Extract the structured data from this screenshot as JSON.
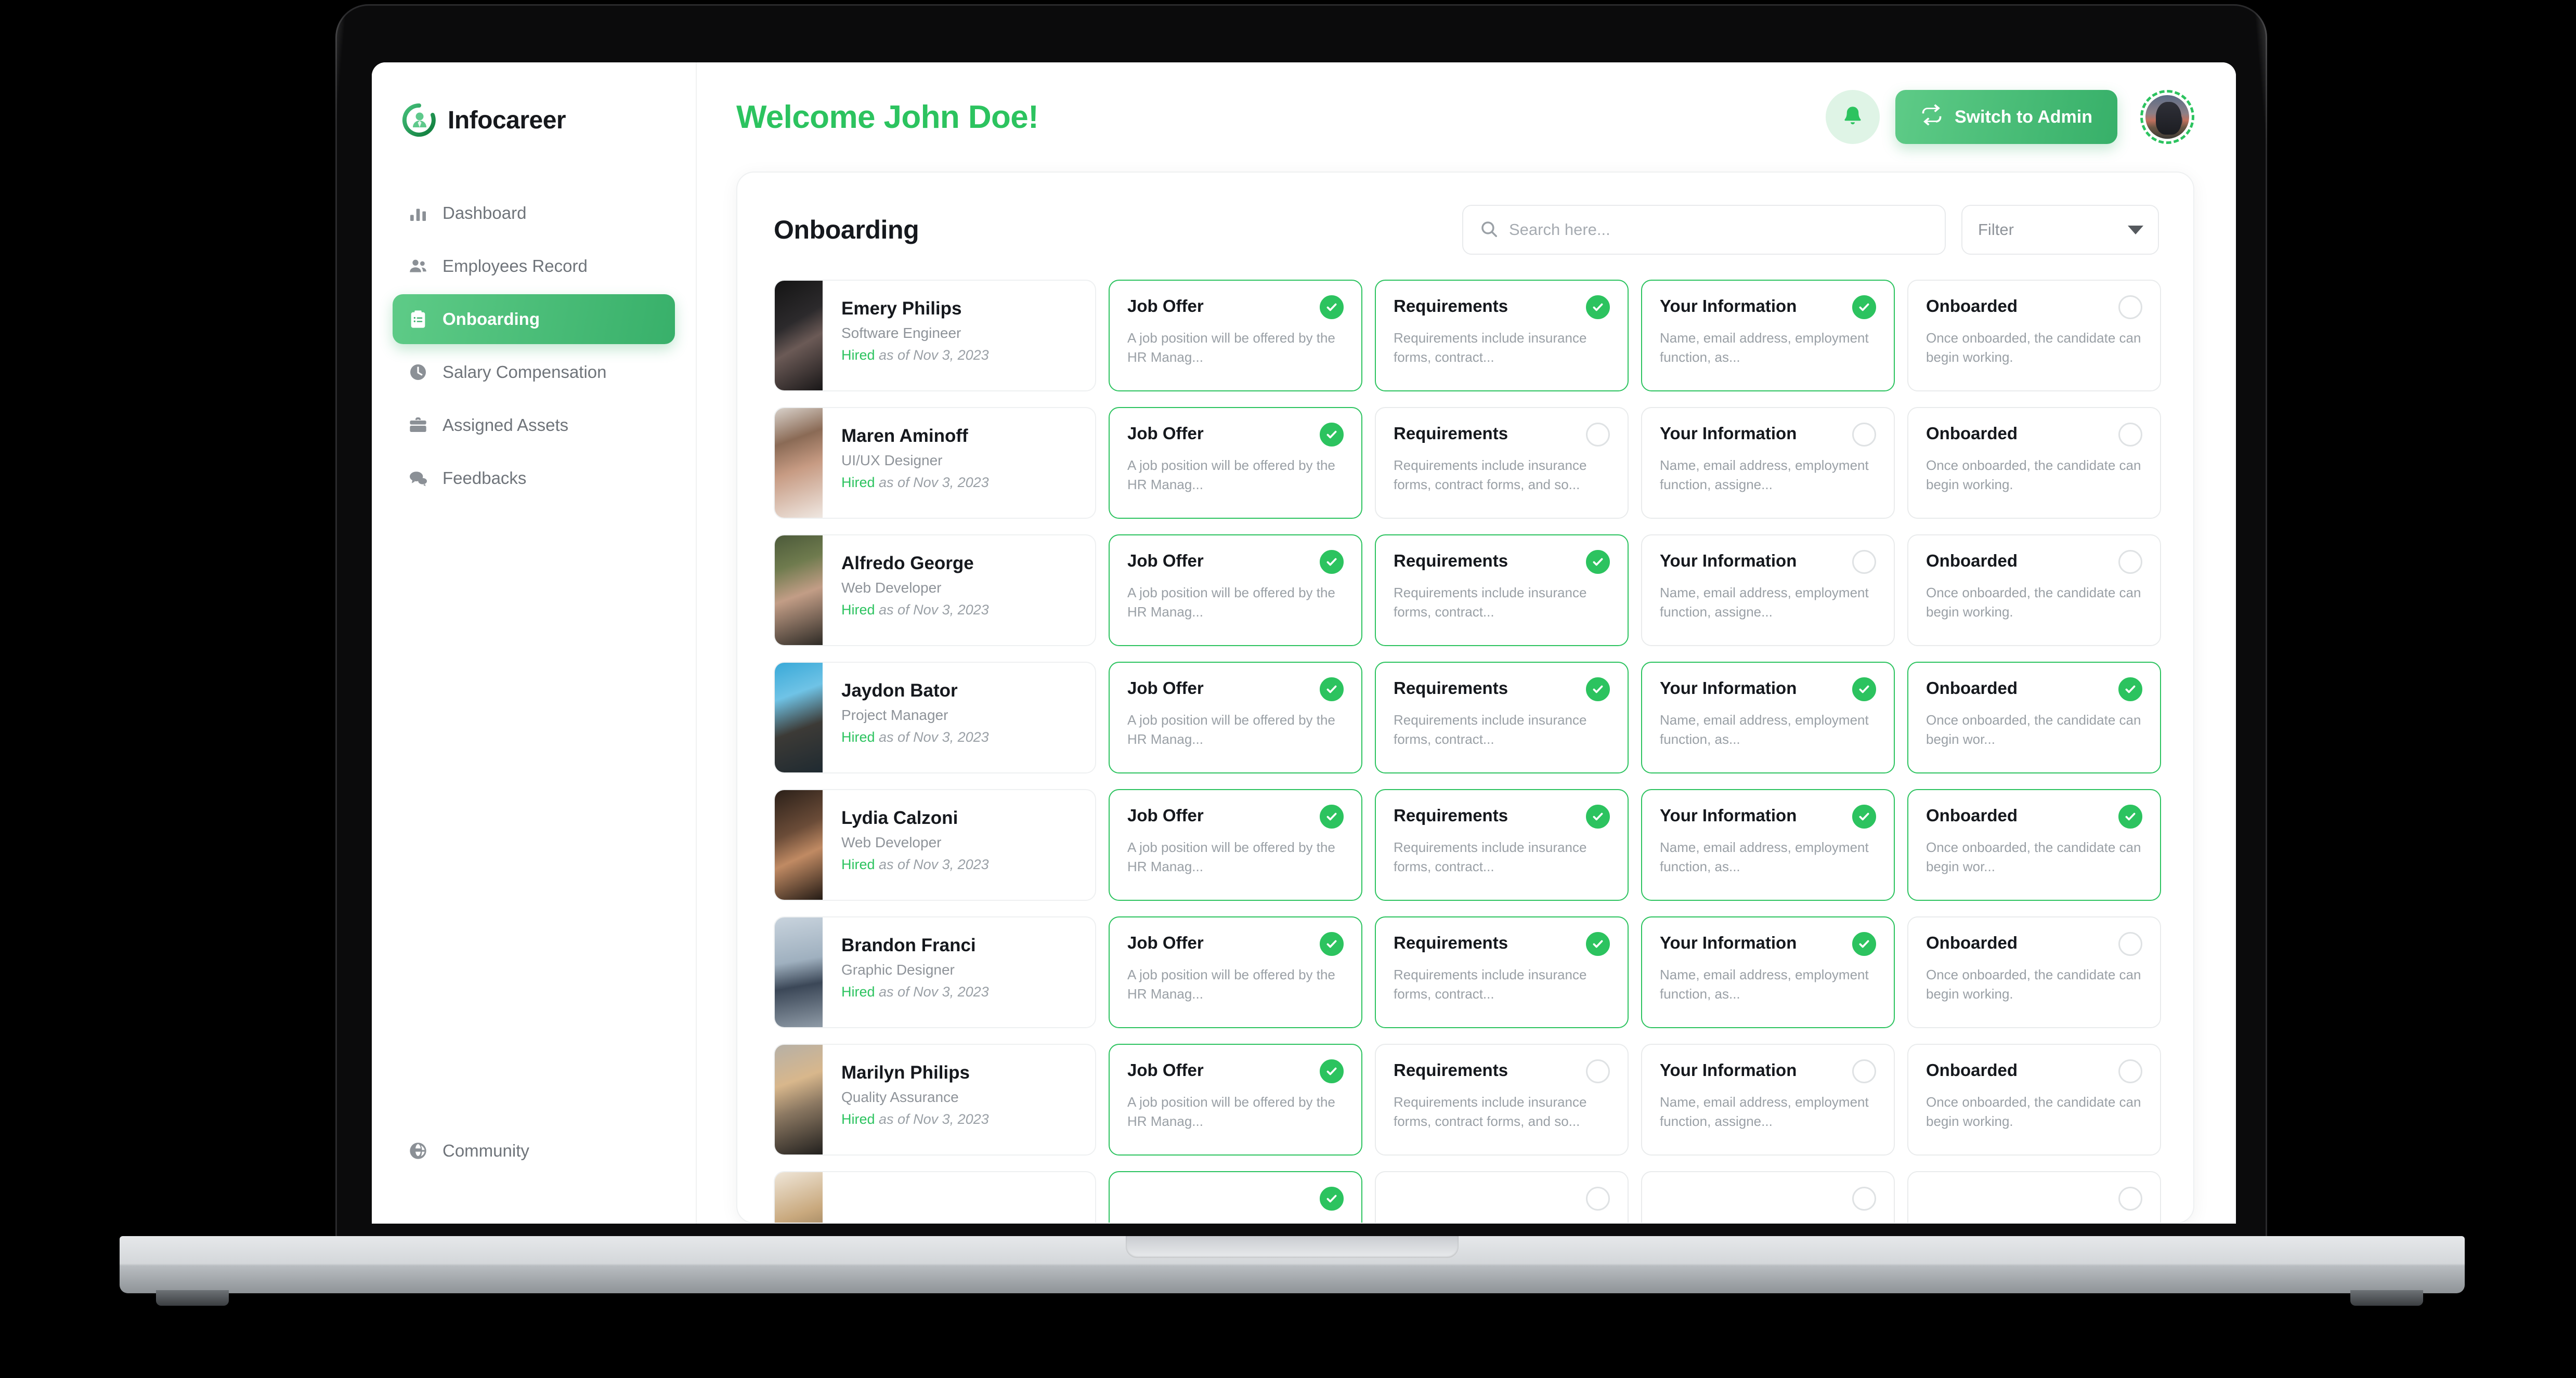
{
  "brand": {
    "name": "Infocareer",
    "logo_icon": "infocareer-person-circle-logo",
    "accent": "#2cc35f"
  },
  "sidebar": {
    "items": [
      {
        "label": "Dashboard",
        "icon": "bar-chart-icon",
        "active": false
      },
      {
        "label": "Employees Record",
        "icon": "people-icon",
        "active": false
      },
      {
        "label": "Onboarding",
        "icon": "clipboard-list-icon",
        "active": true
      },
      {
        "label": "Salary Compensation",
        "icon": "clock-icon",
        "active": false
      },
      {
        "label": "Assigned Assets",
        "icon": "briefcase-icon",
        "active": false
      },
      {
        "label": "Feedbacks",
        "icon": "chat-bubbles-icon",
        "active": false
      }
    ],
    "bottom": {
      "label": "Community",
      "icon": "globe-icon"
    }
  },
  "topbar": {
    "welcome": "Welcome John Doe!",
    "notifications_icon": "bell-icon",
    "switch_label": "Switch to Admin",
    "switch_icon": "swap-arrows-icon",
    "avatar_name": "user-avatar"
  },
  "panel": {
    "title": "Onboarding",
    "search": {
      "placeholder": "Search here...",
      "value": "",
      "icon": "search-icon"
    },
    "filter": {
      "label": "Filter",
      "icon": "chevron-down-icon"
    }
  },
  "stage_text": {
    "job_offer_title": "Job Offer",
    "job_offer_desc": "A job position will be offered by the HR Manag...",
    "requirements_title": "Requirements",
    "requirements_desc_short": "Requirements include insurance forms, contract...",
    "requirements_desc_long": "Requirements include insurance forms, contract forms, and so...",
    "your_info_title": "Your Information",
    "your_info_desc_short": "Name, email address, employment function, as...",
    "your_info_desc_long": "Name, email address, employment function, assigne...",
    "onboarded_title": "Onboarded",
    "onboarded_desc_pending": "Once onboarded, the candidate can begin working.",
    "onboarded_desc_done": "Once onboarded, the candidate can begin wor..."
  },
  "employees": [
    {
      "name": "Emery Philips",
      "role": "Software Engineer",
      "status_label": "Hired",
      "status_date": "as of Nov 3, 2023",
      "photo": "linear-gradient(150deg,#141414 0%,#2c2a2c 38%,#6b5a56 58%,#191718 100%)",
      "stages": [
        {
          "title": "Job Offer",
          "desc": "A job position will be offered by the HR Manag...",
          "done": true
        },
        {
          "title": "Requirements",
          "desc": "Requirements include insurance forms, contract...",
          "done": true
        },
        {
          "title": "Your Information",
          "desc": "Name, email address, employment function, as...",
          "done": true
        },
        {
          "title": "Onboarded",
          "desc": "Once onboarded, the candidate can begin working.",
          "done": false
        }
      ]
    },
    {
      "name": "Maren Aminoff",
      "role": "UI/UX Designer",
      "status_label": "Hired",
      "status_date": "as of Nov 3, 2023",
      "photo": "linear-gradient(160deg,#d9d2cb 0%,#8a6a55 30%,#c79b83 55%,#efe7e1 100%)",
      "stages": [
        {
          "title": "Job Offer",
          "desc": "A job position will be offered by the HR Manag...",
          "done": true
        },
        {
          "title": "Requirements",
          "desc": "Requirements include insurance forms, contract forms, and so...",
          "done": false
        },
        {
          "title": "Your Information",
          "desc": "Name, email address, employment function, assigne...",
          "done": false
        },
        {
          "title": "Onboarded",
          "desc": "Once onboarded, the candidate can begin working.",
          "done": false
        }
      ]
    },
    {
      "name": "Alfredo George",
      "role": "Web Developer",
      "status_label": "Hired",
      "status_date": "as of Nov 3, 2023",
      "photo": "linear-gradient(160deg,#4c5a3a 0%,#6f7b4e 28%,#c29d86 54%,#2e2b26 100%)",
      "stages": [
        {
          "title": "Job Offer",
          "desc": "A job position will be offered by the HR Manag...",
          "done": true
        },
        {
          "title": "Requirements",
          "desc": "Requirements include insurance forms, contract...",
          "done": true
        },
        {
          "title": "Your Information",
          "desc": "Name, email address, employment function, assigne...",
          "done": false
        },
        {
          "title": "Onboarded",
          "desc": "Once onboarded, the candidate can begin working.",
          "done": false
        }
      ]
    },
    {
      "name": "Jaydon Bator",
      "role": "Project Manager",
      "status_label": "Hired",
      "status_date": "as of Nov 3, 2023",
      "photo": "linear-gradient(160deg,#39a9d8 0%,#6fc3e6 30%,#3c3a36 60%,#1f2a31 100%)",
      "stages": [
        {
          "title": "Job Offer",
          "desc": "A job position will be offered by the HR Manag...",
          "done": true
        },
        {
          "title": "Requirements",
          "desc": "Requirements include insurance forms, contract...",
          "done": true
        },
        {
          "title": "Your Information",
          "desc": "Name, email address, employment function, as...",
          "done": true
        },
        {
          "title": "Onboarded",
          "desc": "Once onboarded, the candidate can begin wor...",
          "done": true
        }
      ]
    },
    {
      "name": "Lydia Calzoni",
      "role": "Web Developer",
      "status_label": "Hired",
      "status_date": "as of Nov 3, 2023",
      "photo": "linear-gradient(155deg,#2b2019 0%,#6b4c38 38%,#c08a63 60%,#241b15 100%)",
      "stages": [
        {
          "title": "Job Offer",
          "desc": "A job position will be offered by the HR Manag...",
          "done": true
        },
        {
          "title": "Requirements",
          "desc": "Requirements include insurance forms, contract...",
          "done": true
        },
        {
          "title": "Your Information",
          "desc": "Name, email address, employment function, as...",
          "done": true
        },
        {
          "title": "Onboarded",
          "desc": "Once onboarded, the candidate can begin wor...",
          "done": true
        }
      ]
    },
    {
      "name": "Brandon Franci",
      "role": "Graphic Designer",
      "status_label": "Hired",
      "status_date": "as of Nov 3, 2023",
      "photo": "linear-gradient(170deg,#c8d3dd 0%,#9fb0bf 40%,#3b4757 62%,#8e9aa6 100%)",
      "stages": [
        {
          "title": "Job Offer",
          "desc": "A job position will be offered by the HR Manag...",
          "done": true
        },
        {
          "title": "Requirements",
          "desc": "Requirements include insurance forms, contract...",
          "done": true
        },
        {
          "title": "Your Information",
          "desc": "Name, email address, employment function, as...",
          "done": true
        },
        {
          "title": "Onboarded",
          "desc": "Once onboarded, the candidate can begin working.",
          "done": false
        }
      ]
    },
    {
      "name": "Marilyn Philips",
      "role": "Quality Assurance",
      "status_label": "Hired",
      "status_date": "as of Nov 3, 2023",
      "photo": "linear-gradient(160deg,#b6b0a6 0%,#d8b78c 34%,#8a7761 58%,#22201e 100%)",
      "stages": [
        {
          "title": "Job Offer",
          "desc": "A job position will be offered by the HR Manag...",
          "done": true
        },
        {
          "title": "Requirements",
          "desc": "Requirements include insurance forms, contract forms, and so...",
          "done": false
        },
        {
          "title": "Your Information",
          "desc": "Name, email address, employment function, assigne...",
          "done": false
        },
        {
          "title": "Onboarded",
          "desc": "Once onboarded, the candidate can begin working.",
          "done": false
        }
      ]
    },
    {
      "name": "",
      "role": "",
      "status_label": "",
      "status_date": "",
      "photo": "linear-gradient(160deg,#efe6d8 0%,#c9a97e 40%,#8d7553 70%,#efe9de 100%)",
      "stages": [
        {
          "title": "",
          "desc": "",
          "done": true
        },
        {
          "title": "",
          "desc": "",
          "done": false
        },
        {
          "title": "",
          "desc": "",
          "done": false
        },
        {
          "title": "",
          "desc": "",
          "done": false
        }
      ]
    }
  ]
}
